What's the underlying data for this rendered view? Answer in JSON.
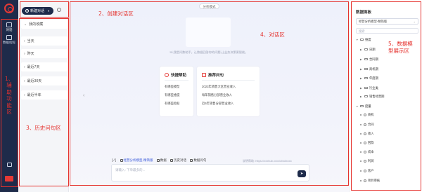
{
  "rail": {
    "chat_label": "对话",
    "data_label": "数据指标"
  },
  "history": {
    "new_chat": "新建对话",
    "items": [
      "我的收藏",
      "当天",
      "昨天",
      "最近7天",
      "最近30天",
      "最近半年"
    ]
  },
  "main": {
    "mode": "分析模式",
    "welcome": "Hi,我是问数助手。让数据回答你的问题,让业务决策更智能。",
    "quick_help": {
      "title": "快捷帮助",
      "lines": [
        "有哪些模型",
        "有哪些维度",
        "有哪些指标"
      ]
    },
    "recommended": {
      "title": "推荐问句",
      "lines": [
        "2023年销售大区营业收入",
        "每年销售分部营业收入",
        "近5年销售分部营业收入"
      ]
    },
    "toolbar": {
      "slash": "[ / ]",
      "model": "经营分析模型-精简版",
      "chart": "数据",
      "history": "历史对话",
      "favorite": "数据问句"
    },
    "hint": "说明帮助: https://xxxhub.xxxx/chat/xxxx",
    "input_placeholder": "请输入: 下单最多的..."
  },
  "right_panel": {
    "title": "数据面板",
    "model_select": "经营分析模型-精简版",
    "search_placeholder": "搜索",
    "dimensions_group": "维度",
    "dimensions": [
      "日期",
      "合同期",
      "商机期",
      "年度期",
      "行业类",
      "销售经营期"
    ],
    "measures_group": "度量",
    "measures": [
      "商机",
      "合同",
      "收入",
      "回款",
      "成本",
      "利润",
      "客户",
      "项目审核"
    ]
  },
  "annotations": {
    "a1": "1、辅助功能区",
    "a2": "2、创建对话区",
    "a3": "3、历史问句区",
    "a4": "4、对话区",
    "a5": "5、数据模型展示区"
  },
  "colors": {
    "accent_red": "#e5322e",
    "navy": "#1e2b4a"
  }
}
